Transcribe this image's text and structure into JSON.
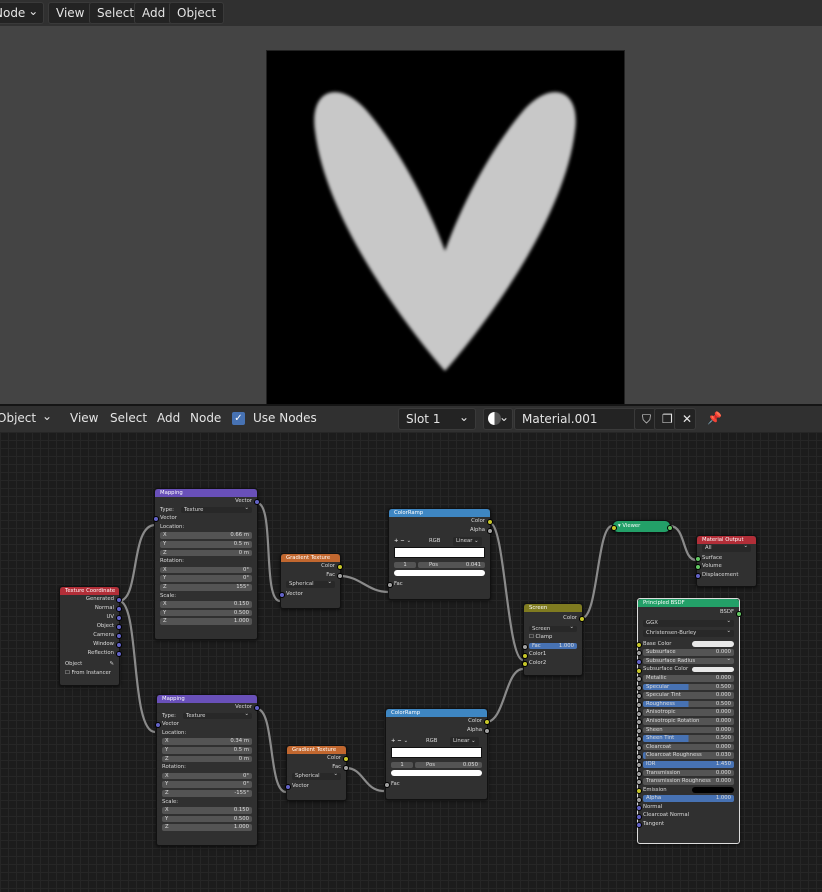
{
  "image_editor_header": {
    "mode": "Node",
    "menu": [
      "View",
      "Select",
      "Add",
      "Object"
    ]
  },
  "node_editor_header": {
    "type": "Object",
    "menu": [
      "View",
      "Select",
      "Add",
      "Node"
    ],
    "use_nodes_label": "Use Nodes",
    "slot": "Slot 1",
    "material": "Material.001"
  },
  "colors": {
    "header_bg": "#303030",
    "viewport_bg": "#444444",
    "editor_bg": "#1c1c1c",
    "node_bg": "#303030",
    "mapping_header": "#6950b9",
    "texture_coord_header": "#b22e38",
    "gradient_header": "#c1672f",
    "colorramp_header": "#3e86c2",
    "screen_header": "#7f7b20",
    "viewer_header": "#23a068",
    "shader_header": "#23a068",
    "material_output_header": "#b22e38",
    "socket_vector": "#6363c7",
    "socket_color": "#c7c729",
    "socket_float": "#a1a1a1",
    "socket_shader": "#63c763",
    "field_blue": "#4772b3"
  },
  "nodes": {
    "texcoord": {
      "title": "Texture Coordinate",
      "outputs": [
        "Generated",
        "Normal",
        "UV",
        "Object",
        "Camera",
        "Window",
        "Reflection"
      ],
      "object_label": "Object",
      "from_instancer": "From Instancer"
    },
    "mapping1": {
      "title": "Mapping",
      "output": "Vector",
      "type_label": "Type:",
      "type_value": "Texture",
      "vector_label": "Vector",
      "location_label": "Location:",
      "location": [
        [
          "X",
          "0.66 m"
        ],
        [
          "Y",
          "0.5 m"
        ],
        [
          "Z",
          "0 m"
        ]
      ],
      "rotation_label": "Rotation:",
      "rotation": [
        [
          "X",
          "0°"
        ],
        [
          "Y",
          "0°"
        ],
        [
          "Z",
          "155°"
        ]
      ],
      "scale_label": "Scale:",
      "scale": [
        [
          "X",
          "0.150"
        ],
        [
          "Y",
          "0.500"
        ],
        [
          "Z",
          "1.000"
        ]
      ]
    },
    "mapping2": {
      "title": "Mapping",
      "output": "Vector",
      "type_label": "Type:",
      "type_value": "Texture",
      "vector_label": "Vector",
      "location_label": "Location:",
      "location": [
        [
          "X",
          "0.34 m"
        ],
        [
          "Y",
          "0.5 m"
        ],
        [
          "Z",
          "0 m"
        ]
      ],
      "rotation_label": "Rotation:",
      "rotation": [
        [
          "X",
          "0°"
        ],
        [
          "Y",
          "0°"
        ],
        [
          "Z",
          "-155°"
        ]
      ],
      "scale_label": "Scale:",
      "scale": [
        [
          "X",
          "0.150"
        ],
        [
          "Y",
          "0.500"
        ],
        [
          "Z",
          "1.000"
        ]
      ]
    },
    "gradient1": {
      "title": "Gradient Texture",
      "outputs": [
        "Color",
        "Fac"
      ],
      "type": "Spherical",
      "input": "Vector"
    },
    "gradient2": {
      "title": "Gradient Texture",
      "outputs": [
        "Color",
        "Fac"
      ],
      "type": "Spherical",
      "input": "Vector"
    },
    "ramp1": {
      "title": "ColorRamp",
      "outputs": [
        "Color",
        "Alpha"
      ],
      "color_mode": "RGB",
      "interpolation": "Linear",
      "index": "1",
      "pos_label": "Pos",
      "pos_value": "0.041",
      "input": "Fac"
    },
    "ramp2": {
      "title": "ColorRamp",
      "outputs": [
        "Color",
        "Alpha"
      ],
      "color_mode": "RGB",
      "interpolation": "Linear",
      "index": "1",
      "pos_label": "Pos",
      "pos_value": "0.050",
      "input": "Fac"
    },
    "screen": {
      "title": "Screen",
      "output": "Color",
      "blend": "Screen",
      "clamp": "Clamp",
      "fac_label": "Fac",
      "fac_value": "1.000",
      "inputs": [
        "Color1",
        "Color2"
      ]
    },
    "viewer": {
      "title": "Viewer"
    },
    "output": {
      "title": "Material Output",
      "target": "All",
      "inputs": [
        "Surface",
        "Volume",
        "Displacement"
      ]
    },
    "bsdf": {
      "title": "Principled BSDF",
      "output": "BSDF",
      "distribution": "GGX",
      "subsurface_method": "Christensen-Burley",
      "base_color": "Base Color",
      "subsurface": [
        "Subsurface",
        "0.000"
      ],
      "subsurface_radius": "Subsurface Radius",
      "subsurface_color": "Subsurface Color",
      "params": [
        [
          "Metallic",
          "0.000"
        ],
        [
          "Specular",
          "0.500"
        ],
        [
          "Specular Tint",
          "0.000"
        ],
        [
          "Roughness",
          "0.500"
        ],
        [
          "Anisotropic",
          "0.000"
        ],
        [
          "Anisotropic Rotation",
          "0.000"
        ],
        [
          "Sheen",
          "0.000"
        ],
        [
          "Sheen Tint",
          "0.500"
        ],
        [
          "Clearcoat",
          "0.000"
        ],
        [
          "Clearcoat Roughness",
          "0.030"
        ],
        [
          "IOR",
          "1.450"
        ],
        [
          "Transmission",
          "0.000"
        ],
        [
          "Transmission Roughness",
          "0.000"
        ]
      ],
      "emission": "Emission",
      "alpha": [
        "Alpha",
        "1.000"
      ],
      "vector_inputs": [
        "Normal",
        "Clearcoat Normal",
        "Tangent"
      ]
    }
  }
}
